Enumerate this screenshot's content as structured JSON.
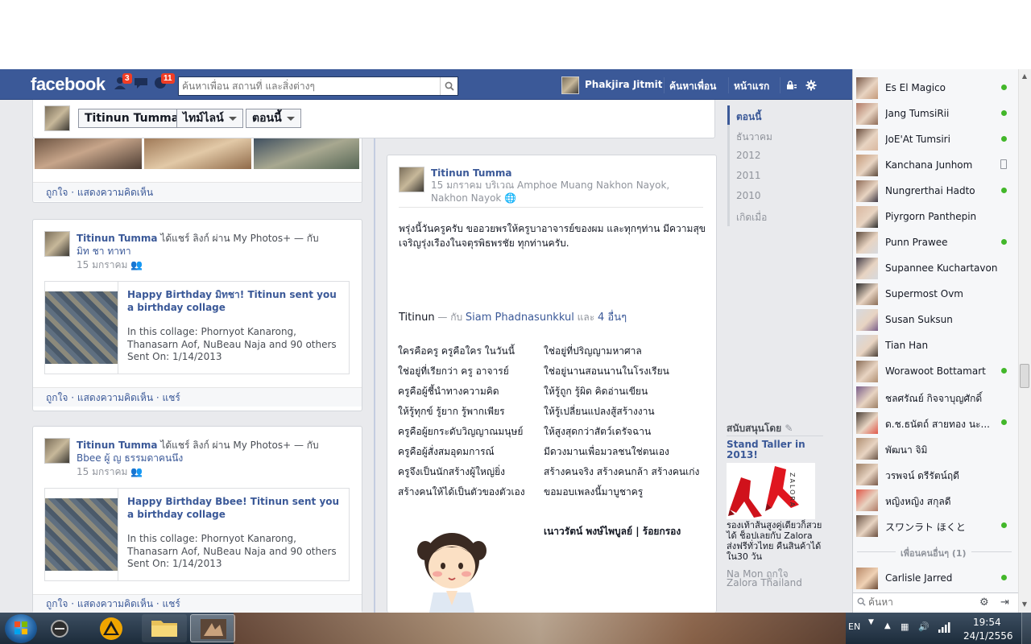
{
  "header": {
    "logo": "facebook",
    "friend_requests_count": "3",
    "notifications_count": "11",
    "search_placeholder": "ค้นหาเพื่อน สถานที่ และสิ่งต่างๆ",
    "profile_name": "Phakjira Jitmit",
    "find_friends": "ค้นหาเพื่อน",
    "home": "หน้าแรก"
  },
  "timeline_bar": {
    "name": "Titinun Tumma",
    "timeline": "ไทม์ไลน์",
    "now": "ตอนนี้"
  },
  "top_card": {
    "actions": "ถูกใจ · แสดงความคิดเห็น"
  },
  "post1": {
    "name": "Titinun Tumma",
    "shared": " ได้แชร์ ลิงก์ ผ่าน My Photos+ — กับ ",
    "with": "มิท ชา ทาทา",
    "date": "15 มกราคม",
    "link_title": "Happy Birthday มิทชา! Titinun sent you a birthday collage",
    "link_desc": "In this collage: Phornyot Kanarong, Thanasarn Aof, NuBeau Naja and 90 others",
    "sent_on": "Sent On: 1/14/2013",
    "actions": "ถูกใจ · แสดงความคิดเห็น · แชร์"
  },
  "post2": {
    "name": "Titinun Tumma",
    "shared": " ได้แชร์ ลิงก์ ผ่าน My Photos+ — กับ ",
    "with": "Bbee ผู้ ญ ธรรมดาคนนึง",
    "date": "15 มกราคม",
    "link_title": "Happy Birthday Bbee! Titinun sent you a birthday collage",
    "link_desc": "In this collage: Phornyot Kanarong, Thanasarn Aof, NuBeau Naja and 90 others",
    "sent_on": "Sent On: 1/14/2013",
    "actions": "ถูกใจ · แสดงความคิดเห็น · แชร์"
  },
  "main_post": {
    "name": "Titinun Tumma",
    "date_location": "15 มกราคม บริเวณ Amphoe Muang Nakhon Nayok, Nakhon Nayok",
    "text1": "พรุ่งนี้วันครูครับ ขออวยพรให้ครูบาอาจารย์ของผม และทุกๆท่าน มีความสุข เจริญรุ่งเรืองในจตุรพิธพรชัย ทุกท่านครับ.",
    "tag_author": "Titinun",
    "tag_mid": " — กับ ",
    "tag_person": "Siam Phadnasunkkul",
    "tag_and": " และ ",
    "tag_others": "4 อื่นๆ",
    "poem_left": [
      "ใครคือครู ครูคือใคร ในวันนี้",
      "ใช่อยู่ที่เรียกว่า ครู อาจารย์",
      "ครูคือผู้ชี้นำทางความคิด",
      "ให้รู้ทุกข์ รู้ยาก รู้พากเพียร",
      "ครูคือผู้ยกระดับวิญญาณมนุษย์",
      "ครูคือผู้สั่งสมอุดมการณ์",
      "ครูจึงเป็นนักสร้างผู้ใหญ่ยิ่ง",
      "สร้างคนให้ได้เป็นตัวของตัวเอง"
    ],
    "poem_right": [
      "ใช่อยู่ที่ปริญญามหาศาล",
      "ใช่อยู่นานสอนนานในโรงเรียน",
      "ให้รู้ถูก รู้ผิด คิดอ่านเขียน",
      "ให้รู้เปลี่ยนแปลงสู้สร้างงาน",
      "ให้สูงสุดกว่าสัตว์เดรัจฉาน",
      "มีดวงมานเพื่อมวลชนใช่ตนเอง",
      "สร้างคนจริง สร้างคนกล้า สร้างคนเก่ง",
      "ขอมอบเพลงนี้มาบูชาครู"
    ],
    "poem_author": "เนาวรัตน์ พงษ์ไพบูลย์ | ร้อยกรอง"
  },
  "years": [
    "ตอนนี้",
    "ธันวาคม",
    "2012",
    "2011",
    "2010",
    "เกิดเมื่อ"
  ],
  "sponsored": {
    "header": "สนับสนุนโดย",
    "ad_title": "Stand Taller in 2013!",
    "ad_brand_mark": "ZALORA",
    "ad_text": "รองเท้าส้นสูงคู่เดียวก็สวยได้ ช็อปเลยกับ Zalora ส่งฟรีทั่วไทย คืนสินค้าได้ใน30 วัน",
    "ad_social": "Na Mon ถูกใจ",
    "ad_page": "Zalora Thailand"
  },
  "chat": {
    "friends": [
      {
        "name": "Es El Magico",
        "status": "online"
      },
      {
        "name": "Jang TumsiRii",
        "status": "online"
      },
      {
        "name": "JoE'At Tumsiri",
        "status": "online"
      },
      {
        "name": "Kanchana Junhom",
        "status": "mobile"
      },
      {
        "name": "Nungrerthai Hadto",
        "status": "online"
      },
      {
        "name": "Piyrgorn Panthepin",
        "status": "none"
      },
      {
        "name": "Punn Prawee",
        "status": "online"
      },
      {
        "name": "Supannee Kuchartavon",
        "status": "none"
      },
      {
        "name": "Supermost Ovm",
        "status": "none"
      },
      {
        "name": "Susan Suksun",
        "status": "none"
      },
      {
        "name": "Tian Han",
        "status": "none"
      },
      {
        "name": "Worawoot Bottamart",
        "status": "online"
      },
      {
        "name": "ชลศรัณย์ กิจจาบุญศักดิ์",
        "status": "none"
      },
      {
        "name": "ด.ช.ธนัตถ์ สายทอง นะ...",
        "status": "online"
      },
      {
        "name": "พัฒนา จิมิ",
        "status": "none"
      },
      {
        "name": "วรพจน์ ดรีรัตน์ฤดี",
        "status": "none"
      },
      {
        "name": "หญิงหญิง สกุลดี",
        "status": "none"
      },
      {
        "name": "スワンラト ほくと",
        "status": "online"
      }
    ],
    "more_friends": "เพื่อนคนอื่นๆ (1)",
    "extra_friend": "Carlisle Jarred",
    "search_placeholder": "ค้นหา"
  },
  "taskbar": {
    "lang": "EN",
    "time": "19:54",
    "date": "24/1/2556"
  }
}
